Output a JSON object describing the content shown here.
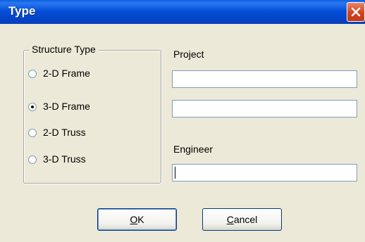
{
  "window": {
    "title": "Type"
  },
  "structure_type": {
    "label": "Structure Type",
    "options": [
      {
        "label": "2-D Frame",
        "checked": false
      },
      {
        "label": "3-D Frame",
        "checked": true
      },
      {
        "label": "2-D Truss",
        "checked": false
      },
      {
        "label": "3-D Truss",
        "checked": false
      }
    ]
  },
  "project": {
    "label": "Project",
    "line1_value": "",
    "line2_value": ""
  },
  "engineer": {
    "label": "Engineer",
    "value": ""
  },
  "buttons": {
    "ok": {
      "underline": "O",
      "rest": "K"
    },
    "cancel": {
      "underline": "C",
      "rest": "ancel"
    }
  },
  "icons": {
    "close": "close-icon"
  }
}
